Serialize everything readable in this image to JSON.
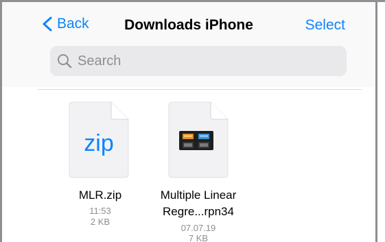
{
  "nav": {
    "back_label": "Back",
    "title": "Downloads iPhone",
    "select_label": "Select"
  },
  "search": {
    "placeholder": "Search",
    "value": ""
  },
  "files": [
    {
      "name_line1": "MLR.zip",
      "name_line2": "",
      "time": "11:53",
      "size": "2 KB",
      "thumbnail": "zip",
      "icon": "zip-document-icon"
    },
    {
      "name_line1": "Multiple Linear",
      "name_line2": "Regre...rpn34",
      "time": "07.07.19",
      "size": "7 KB",
      "icon": "calculator-document-icon"
    }
  ],
  "colors": {
    "accent": "#0a84ff",
    "secondary_text": "#8e8e93",
    "search_bg": "#e9e9eb"
  }
}
